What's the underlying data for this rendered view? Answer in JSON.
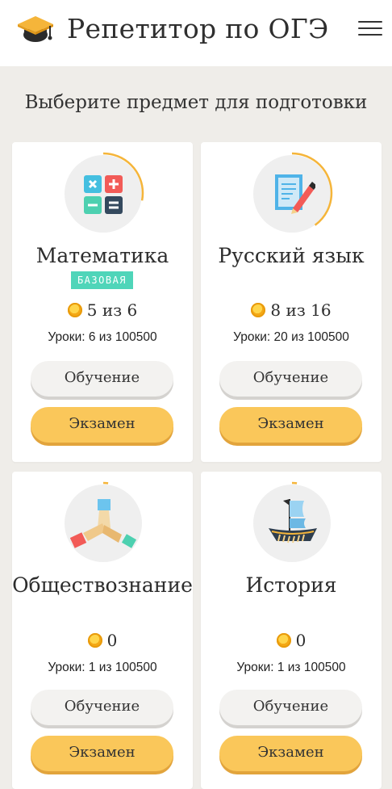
{
  "header": {
    "title": "Репетитор по ОГЭ"
  },
  "page": {
    "heading": "Выберите предмет для подготовки"
  },
  "colors": {
    "accent": "#fac75a",
    "badge": "#4fd5b9",
    "progress_ring": "#f5b53a"
  },
  "subjects": [
    {
      "name": "Математика",
      "icon": "calculator-icon",
      "badge": "БАЗОВАЯ",
      "score": "5 из 6",
      "lessons": "Уроки: 6 из 100500",
      "progress": 0.28,
      "learn_label": "Обучение",
      "exam_label": "Экзамен"
    },
    {
      "name": "Русский язык",
      "icon": "notepad-pencil-icon",
      "score": "8 из 16",
      "lessons": "Уроки: 20 из 100500",
      "progress": 0.4,
      "learn_label": "Обучение",
      "exam_label": "Экзамен"
    },
    {
      "name": "Обществознание",
      "icon": "joined-hands-icon",
      "score": "0",
      "lessons": "Уроки: 1 из 100500",
      "progress": 0.02,
      "learn_label": "Обучение",
      "exam_label": "Экзамен"
    },
    {
      "name": "История",
      "icon": "ship-icon",
      "score": "0",
      "lessons": "Уроки: 1 из 100500",
      "progress": 0.02,
      "learn_label": "Обучение",
      "exam_label": "Экзамен"
    }
  ]
}
